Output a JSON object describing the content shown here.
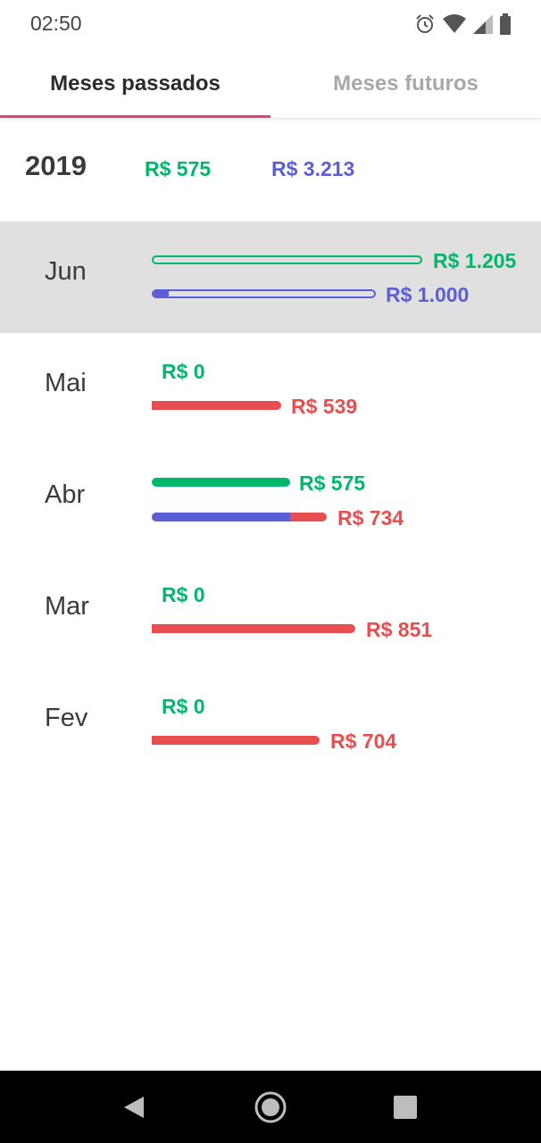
{
  "status_bar": {
    "time": "02:50",
    "icons": [
      "alarm-icon",
      "wifi-icon",
      "signal-icon",
      "battery-icon"
    ]
  },
  "tabs": [
    {
      "label": "Meses passados",
      "active": true
    },
    {
      "label": "Meses futuros",
      "active": false
    }
  ],
  "colors": {
    "income": "#00b86b",
    "planned": "#5a5fd6",
    "expense": "#e84e50",
    "accent": "#e8416a",
    "selected_row": "#e0e0e0"
  },
  "summary": {
    "year": "2019",
    "income": "R$ 575",
    "expense": "R$ 3.213"
  },
  "months": [
    {
      "name": "Jun",
      "selected": true,
      "income_label": "R$ 1.205",
      "income_value": 1205,
      "expense_label": "R$ 1.000",
      "expense_value": 1000,
      "expense_progress": 0.07
    },
    {
      "name": "Mai",
      "selected": false,
      "income_label": "R$ 0",
      "income_value": 0,
      "expense_label": "R$ 539",
      "expense_value": 539
    },
    {
      "name": "Abr",
      "selected": false,
      "income_label": "R$ 575",
      "income_value": 575,
      "expense_label": "R$ 734",
      "expense_value": 734,
      "expense_split_planned": 0.79
    },
    {
      "name": "Mar",
      "selected": false,
      "income_label": "R$ 0",
      "income_value": 0,
      "expense_label": "R$ 851",
      "expense_value": 851
    },
    {
      "name": "Fev",
      "selected": false,
      "income_label": "R$ 0",
      "income_value": 0,
      "expense_label": "R$ 704",
      "expense_value": 704
    }
  ],
  "nav_bar": {
    "buttons": [
      "back-icon",
      "home-icon",
      "recents-icon"
    ]
  }
}
